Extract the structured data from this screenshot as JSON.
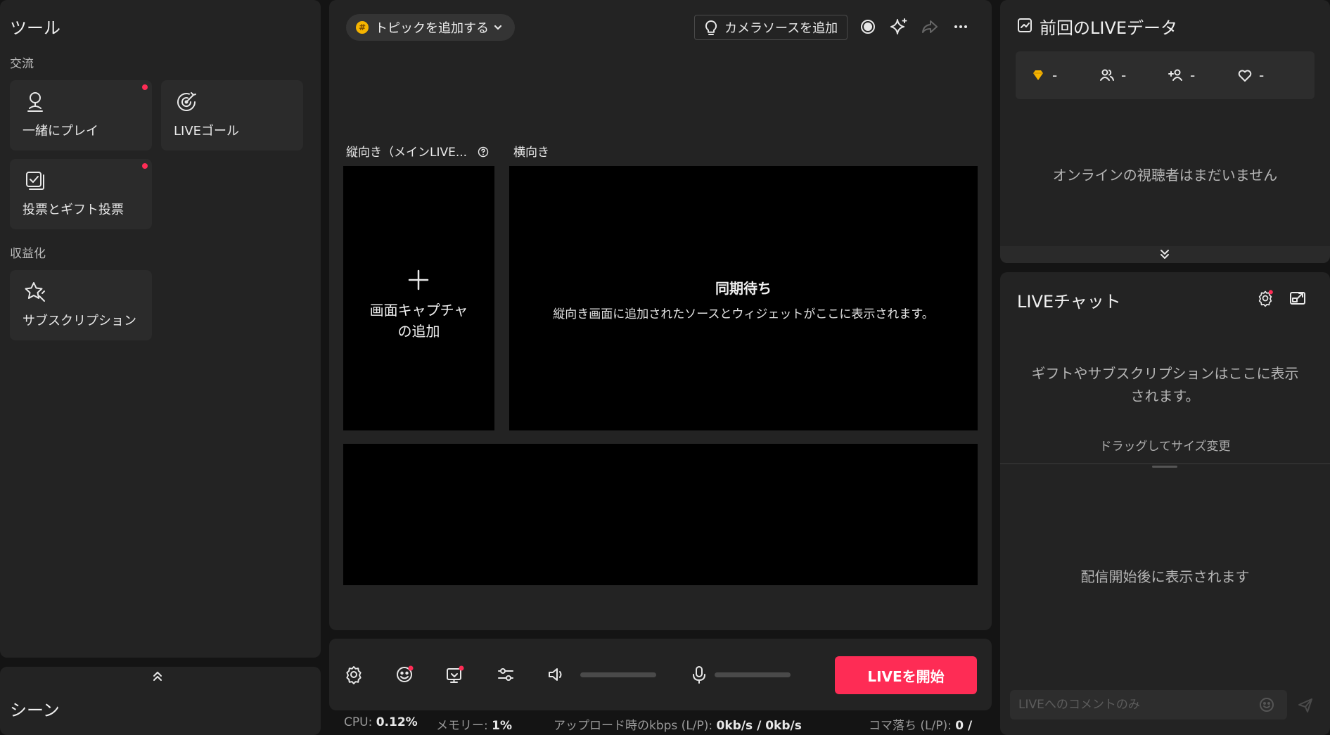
{
  "tools": {
    "title": "ツール",
    "section_interaction": "交流",
    "section_monetize": "収益化",
    "items": [
      {
        "label": "一緒にプレイ",
        "icon": "person-icon",
        "dot": true
      },
      {
        "label": "LIVEゴール",
        "icon": "target-icon",
        "dot": false
      },
      {
        "label": "投票とギフト投票",
        "icon": "poll-icon",
        "dot": true
      },
      {
        "label": "サブスクリプション",
        "icon": "star-icon",
        "dot": false
      }
    ]
  },
  "scenes": {
    "title": "シーン"
  },
  "preview": {
    "topic_button": "トピックを追加する",
    "camera_button": "カメラソースを追加",
    "vertical_label": "縦向き（メインLIVE...",
    "horizontal_label": "横向き",
    "add_capture": "画面キャプチャ\nの追加",
    "sync_title": "同期待ち",
    "sync_desc": "縦向き画面に追加されたソースとウィジェットがここに表示されます。"
  },
  "controls": {
    "start_live": "LIVEを開始"
  },
  "status": {
    "cpu_label": "CPU:",
    "cpu_value": "0.12%",
    "mem_label": "メモリー:",
    "mem_value": "1%",
    "upload_label": "アップロード時のkbps (L/P):",
    "upload_value": "0kb/s / 0kb/s",
    "drop_label": "コマ落ち (L/P):",
    "drop_value": "0 /"
  },
  "last_live": {
    "title": "前回のLIVEデータ",
    "stats": [
      {
        "icon": "diamond-icon",
        "value": "-"
      },
      {
        "icon": "viewers-icon",
        "value": "-"
      },
      {
        "icon": "follower-icon",
        "value": "-"
      },
      {
        "icon": "heart-icon",
        "value": "-"
      }
    ],
    "empty_message": "オンラインの視聴者はまだいません"
  },
  "chat": {
    "title": "LIVEチャット",
    "gift_message": "ギフトやサブスクリプションはここに表示\nされます。",
    "resize_hint": "ドラッグしてサイズ変更",
    "after_start": "配信開始後に表示されます",
    "comment_placeholder": "LIVEへのコメントのみ"
  },
  "colors": {
    "accent": "#fe2c55",
    "panel": "#232323",
    "background": "#141414"
  }
}
